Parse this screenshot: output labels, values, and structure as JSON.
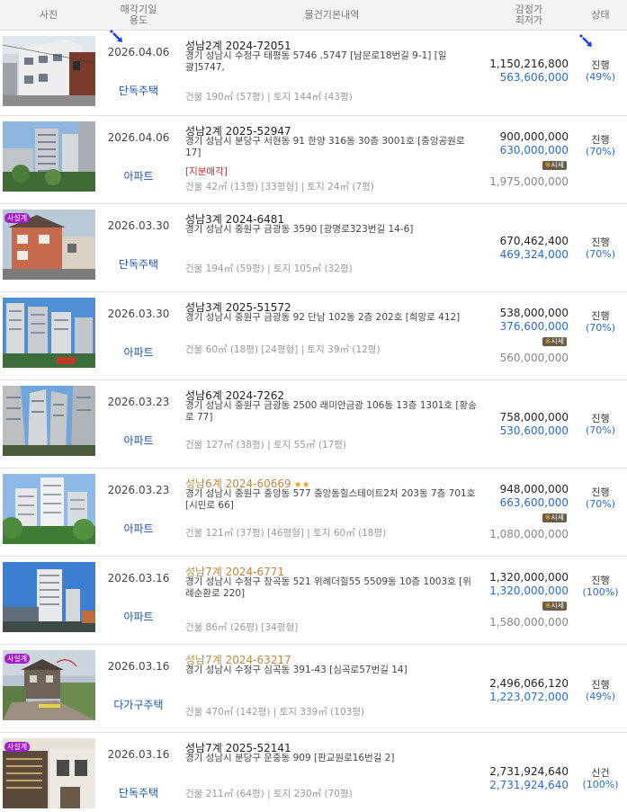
{
  "headers": {
    "photo": "사진",
    "date_line1": "매각기일",
    "date_line2": "용도",
    "info": "물건기본내역",
    "price_line1": "감정가",
    "price_line2": "최저가",
    "state": "상태"
  },
  "labels": {
    "sise": "시세",
    "badge_sa": "사설계"
  },
  "rows": [
    {
      "date": "2026.04.06",
      "use": "단독주택",
      "case_no": "성남2계 2024-72051",
      "address": "경기 성남시 수정구 태평동 5746 ,5747 [남문로18번길 9-1] [일괄]5747,",
      "area": "건물 190㎡ (57평)  |  토지 144㎡ (43평)",
      "appraisal": "1,150,216,800",
      "min_price": "563,606,000",
      "status": "진행",
      "percent": "(49%)"
    },
    {
      "date": "2026.04.06",
      "use": "아파트",
      "case_no": "성남2계 2025-52947",
      "address": "경기 성남시 분당구 서현동 91 한양 316동 30층 3001호 [중앙공원로 17]",
      "share_note": "[지분매각]",
      "area": "건물 42㎡ (13평) [33평형]  |  토지 24㎡ (7평)",
      "appraisal": "900,000,000",
      "min_price": "630,000,000",
      "market": "1,975,000,000",
      "status": "진행",
      "percent": "(70%)"
    },
    {
      "date": "2026.03.30",
      "use": "단독주택",
      "case_no": "성남3계 2024-6481",
      "address": "경기 성남시 중원구 금광동 3590 [광명로323번길 14-6]",
      "area": "건물 194㎡ (59평)  |  토지 105㎡ (32평)",
      "appraisal": "670,462,400",
      "min_price": "469,324,000",
      "status": "진행",
      "percent": "(70%)"
    },
    {
      "date": "2026.03.30",
      "use": "아파트",
      "case_no": "성남3계 2025-51572",
      "address": "경기 성남시 중원구 금광동 92 단남 102동 2층 202호 [희망로 412]",
      "area": "건물 60㎡ (18평) [24평형]  |  토지 39㎡ (12평)",
      "appraisal": "538,000,000",
      "min_price": "376,600,000",
      "market": "560,000,000",
      "status": "진행",
      "percent": "(70%)"
    },
    {
      "date": "2026.03.23",
      "use": "아파트",
      "case_no": "성남6계 2024-7262",
      "address": "경기 성남시 중원구 금광동 2500 래미안금광 106동 13층 1301호 [황송로 77]",
      "area": "건물 127㎡ (38평)  |  토지 55㎡ (17평)",
      "appraisal": "758,000,000",
      "min_price": "530,600,000",
      "status": "진행",
      "percent": "(70%)"
    },
    {
      "date": "2026.03.23",
      "use": "아파트",
      "case_no": "성남6계 2024-60669",
      "address": "경기 성남시 중원구 중앙동 577 중앙동힐스테이트2차 203동 7층 701호 [시민로 66]",
      "area": "건물 121㎡ (37평) [46평형]  |  토지 60㎡ (18평)",
      "appraisal": "948,000,000",
      "min_price": "663,600,000",
      "market": "1,080,000,000",
      "status": "진행",
      "percent": "(70%)"
    },
    {
      "date": "2026.03.16",
      "use": "아파트",
      "case_no": "성남7계 2024-6771",
      "address": "경기 성남시 수정구 창곡동 521 위례더힐55 5509동 10층 1003호 [위례순환로 220]",
      "area": "건물 86㎡ (26평) [34평형]",
      "appraisal": "1,320,000,000",
      "min_price": "1,320,000,000",
      "market": "1,580,000,000",
      "status": "진행",
      "percent": "(100%)"
    },
    {
      "date": "2026.03.16",
      "use": "다가구주택",
      "case_no": "성남7계 2024-63217",
      "address": "경기 성남시 수정구 심곡동 391-43 [심곡로57번길 14]",
      "area": "건물 470㎡ (142평)  |  토지 339㎡ (103평)",
      "appraisal": "2,496,066,120",
      "min_price": "1,223,072,000",
      "status": "진행",
      "percent": "(49%)"
    },
    {
      "date": "2026.03.16",
      "use": "단독주택",
      "case_no": "성남7계 2025-52141",
      "address": "경기 성남시 분당구 운중동 909 [판교원로16번길 2]",
      "area": "건물 211㎡ (64평)  |  토지 230㎡ (70평)",
      "appraisal": "2,731,924,640",
      "min_price": "2,731,924,640",
      "status": "신건",
      "percent": "(100%)"
    }
  ]
}
